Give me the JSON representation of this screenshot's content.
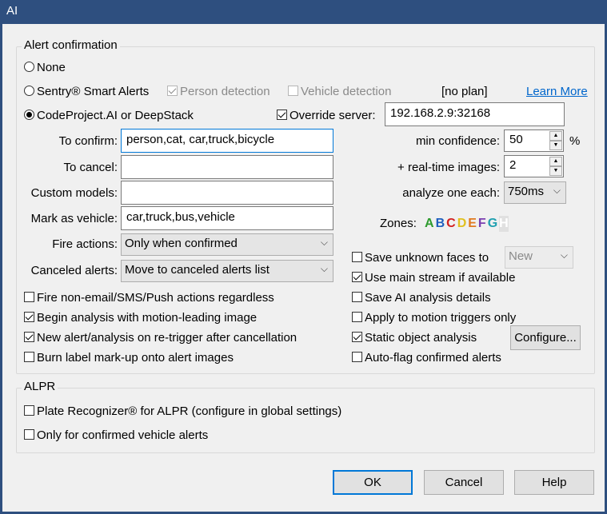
{
  "window": {
    "title": "AI"
  },
  "alert": {
    "legend": "Alert confirmation",
    "opt_none": "None",
    "opt_sentry": "Sentry® Smart Alerts",
    "person_detection": "Person detection",
    "vehicle_detection": "Vehicle detection",
    "plan": "[no plan]",
    "learn_more": "Learn More",
    "opt_codeproject": "CodeProject.AI or DeepStack",
    "override_server": "Override server:",
    "server_value": "192.168.2.9:32168",
    "to_confirm_label": "To confirm:",
    "to_confirm_value": "person,cat, car,truck,bicycle",
    "to_cancel_label": "To cancel:",
    "to_cancel_value": "",
    "custom_models_label": "Custom models:",
    "custom_models_value": "",
    "mark_vehicle_label": "Mark as vehicle:",
    "mark_vehicle_value": "car,truck,bus,vehicle",
    "fire_actions_label": "Fire actions:",
    "fire_actions_value": "Only when confirmed",
    "canceled_alerts_label": "Canceled alerts:",
    "canceled_alerts_value": "Move to canceled alerts list",
    "min_conf_label": "min confidence:",
    "min_conf_value": "50",
    "percent": "%",
    "realtime_label": "+ real-time images:",
    "realtime_value": "2",
    "analyze_label": "analyze one each:",
    "analyze_value": "750ms",
    "zones_label": "Zones:",
    "zones": [
      {
        "letter": "A",
        "color": "#2e9b2e"
      },
      {
        "letter": "B",
        "color": "#1f5fbf"
      },
      {
        "letter": "C",
        "color": "#d22020"
      },
      {
        "letter": "D",
        "color": "#e0c020"
      },
      {
        "letter": "E",
        "color": "#e07a20"
      },
      {
        "letter": "F",
        "color": "#7a3fb0"
      },
      {
        "letter": "G",
        "color": "#20a0b0"
      },
      {
        "letter": "H",
        "color": "#c8c8c8"
      }
    ],
    "save_unknown_faces": "Save unknown faces to",
    "faces_target": "New",
    "use_main_stream": "Use main stream if available",
    "save_ai_details": "Save AI analysis details",
    "apply_motion": "Apply to motion triggers only",
    "static_object": "Static object analysis",
    "configure": "Configure...",
    "auto_flag": "Auto-flag confirmed alerts",
    "fire_non_email": "Fire non-email/SMS/Push actions regardless",
    "begin_analysis": "Begin analysis with motion-leading image",
    "new_alert": "New alert/analysis on re-trigger after cancellation",
    "burn_label": "Burn label mark-up onto alert images"
  },
  "alpr": {
    "legend": "ALPR",
    "plate_recognizer": "Plate Recognizer® for ALPR (configure in global settings)",
    "only_vehicle": "Only for confirmed vehicle alerts"
  },
  "buttons": {
    "ok": "OK",
    "cancel": "Cancel",
    "help": "Help"
  }
}
